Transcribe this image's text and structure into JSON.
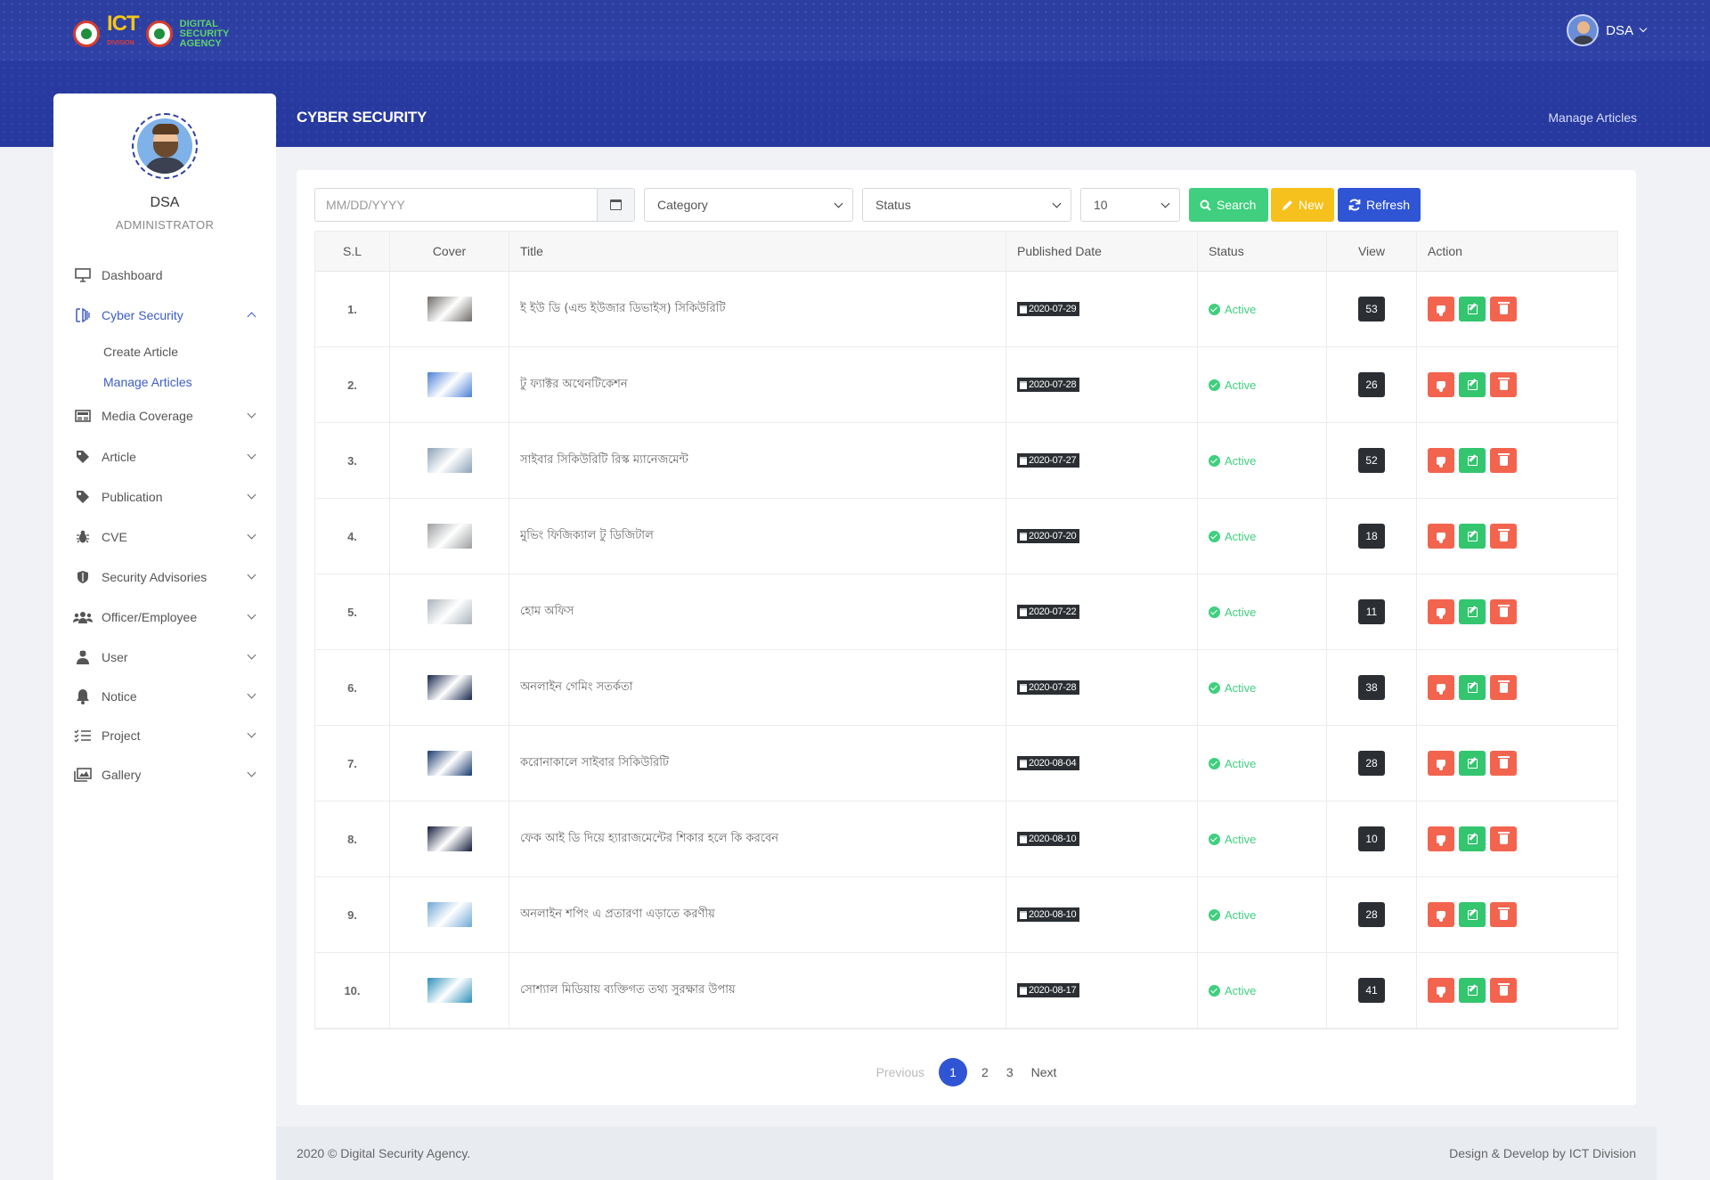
{
  "header": {
    "logo_ict": "ICT",
    "logo_ict_sub": "DIVISION",
    "logo_dsa": "DIGITAL SECURITY AGENCY",
    "user_name": "DSA",
    "page_title": "CYBER SECURITY",
    "breadcrumb": "Manage Articles"
  },
  "sidebar": {
    "name": "DSA",
    "role": "ADMINISTRATOR",
    "items": [
      {
        "label": "Dashboard",
        "icon": "monitor-icon"
      },
      {
        "label": "Cyber Security",
        "icon": "cyber-security-icon"
      },
      {
        "label": "Media Coverage",
        "icon": "newspaper-icon"
      },
      {
        "label": "Article",
        "icon": "tag-icon"
      },
      {
        "label": "Publication",
        "icon": "tag-icon"
      },
      {
        "label": "CVE",
        "icon": "bug-icon"
      },
      {
        "label": "Security Advisories",
        "icon": "shield-icon"
      },
      {
        "label": "Officer/Employee",
        "icon": "users-icon"
      },
      {
        "label": "User",
        "icon": "user-icon"
      },
      {
        "label": "Notice",
        "icon": "bell-icon"
      },
      {
        "label": "Project",
        "icon": "tasks-icon"
      },
      {
        "label": "Gallery",
        "icon": "images-icon"
      }
    ],
    "sub_items": [
      "Create Article",
      "Manage Articles"
    ]
  },
  "filters": {
    "date_placeholder": "MM/DD/YYYY",
    "category": "Category",
    "status": "Status",
    "per_page": "10",
    "search_label": "Search",
    "new_label": "New",
    "refresh_label": "Refresh"
  },
  "table": {
    "headers": [
      "S.L",
      "Cover",
      "Title",
      "Published Date",
      "Status",
      "View",
      "Action"
    ],
    "rows": [
      {
        "sl": "1.",
        "title": "ই ইউ ডি (এন্ড ইউজার ডিভাইস) সিকিউরিটি",
        "date": "2020-07-29",
        "status": "Active",
        "views": "53",
        "cover": "#6d6a66"
      },
      {
        "sl": "2.",
        "title": "টু ফ্যাক্টর অথেনটিকেশন",
        "date": "2020-07-28",
        "status": "Active",
        "views": "26",
        "cover": "#4a7fd8"
      },
      {
        "sl": "3.",
        "title": "সাইবার সিকিউরিটি রিস্ক ম্যানেজমেন্ট",
        "date": "2020-07-27",
        "status": "Active",
        "views": "52",
        "cover": "#8aa0b8"
      },
      {
        "sl": "4.",
        "title": "মুভিং ফিজিক্যাল টু ডিজিটাল",
        "date": "2020-07-20",
        "status": "Active",
        "views": "18",
        "cover": "#9a9d9f"
      },
      {
        "sl": "5.",
        "title": "হোম অফিস",
        "date": "2020-07-22",
        "status": "Active",
        "views": "11",
        "cover": "#a9b3bb"
      },
      {
        "sl": "6.",
        "title": "অনলাইন গেমিং সতর্কতা",
        "date": "2020-07-28",
        "status": "Active",
        "views": "38",
        "cover": "#15244a"
      },
      {
        "sl": "7.",
        "title": "করোনাকালে সাইবার সিকিউরিটি",
        "date": "2020-08-04",
        "status": "Active",
        "views": "28",
        "cover": "#173a6e"
      },
      {
        "sl": "8.",
        "title": "ফেক আই ডি দিয়ে হ্যারাজমেন্টের শিকার হলে কি করবেন",
        "date": "2020-08-10",
        "status": "Active",
        "views": "10",
        "cover": "#141c3a"
      },
      {
        "sl": "9.",
        "title": "অনলাইন শপিং এ প্রতারণা এড়াতে করণীয়",
        "date": "2020-08-10",
        "status": "Active",
        "views": "28",
        "cover": "#6ea7d6"
      },
      {
        "sl": "10.",
        "title": "সোশ্যাল মিডিয়ায় ব্যক্তিগত তথ্য সুরক্ষার উপায়",
        "date": "2020-08-17",
        "status": "Active",
        "views": "41",
        "cover": "#2a8fb8"
      }
    ]
  },
  "pagination": {
    "previous": "Previous",
    "pages": [
      "1",
      "2",
      "3"
    ],
    "current": "1",
    "next": "Next"
  },
  "footer": {
    "left": "2020 © Digital Security Agency.",
    "right": "Design & Develop by ICT Division"
  }
}
